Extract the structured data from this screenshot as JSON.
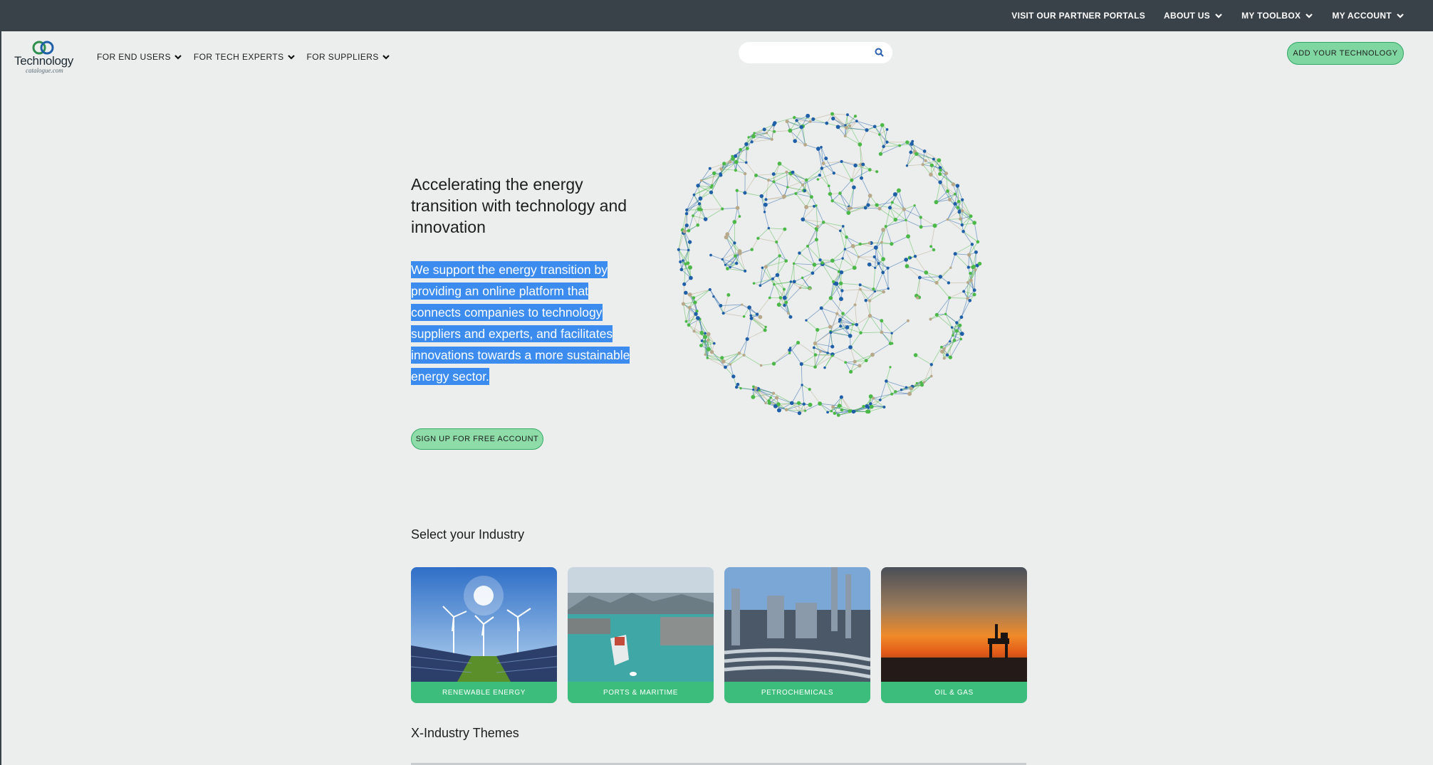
{
  "topbar": {
    "partner_portals": "VISIT OUR PARTNER PORTALS",
    "about_us": "ABOUT US",
    "my_toolbox": "MY TOOLBOX",
    "my_account": "MY ACCOUNT"
  },
  "logo": {
    "word": "Technology",
    "sub": "catalogue.com"
  },
  "nav": {
    "end_users": "FOR END USERS",
    "tech_experts": "FOR TECH EXPERTS",
    "suppliers": "FOR SUPPLIERS"
  },
  "search": {
    "placeholder": "",
    "value": ""
  },
  "add_technology": "ADD YOUR TECHNOLOGY",
  "hero": {
    "title": "Accelerating the energy transition with technology and innovation",
    "text": "We support the energy transition by providing an online platform that connects companies to technology suppliers and experts, and facilitates innovations towards a more sustainable energy sector.",
    "signup": "SIGN UP FOR FREE ACCOUNT"
  },
  "industry": {
    "title": "Select your Industry",
    "cards": [
      {
        "label": "RENEWABLE ENERGY",
        "icon": "renewable-energy-image"
      },
      {
        "label": "PORTS & MARITIME",
        "icon": "ports-maritime-image"
      },
      {
        "label": "PETROCHEMICALS",
        "icon": "petrochemicals-image"
      },
      {
        "label": "OIL & GAS",
        "icon": "oil-gas-image"
      }
    ]
  },
  "themes": {
    "title": "X-Industry Themes"
  },
  "colors": {
    "topbar": "#3a4249",
    "accent_green": "#3cbd7b",
    "button_green": "#8edda9",
    "selection_blue": "#3c8cf0",
    "globe_blue": "#1f5fa8",
    "globe_green": "#4cb848",
    "globe_tan": "#b8a88a"
  }
}
